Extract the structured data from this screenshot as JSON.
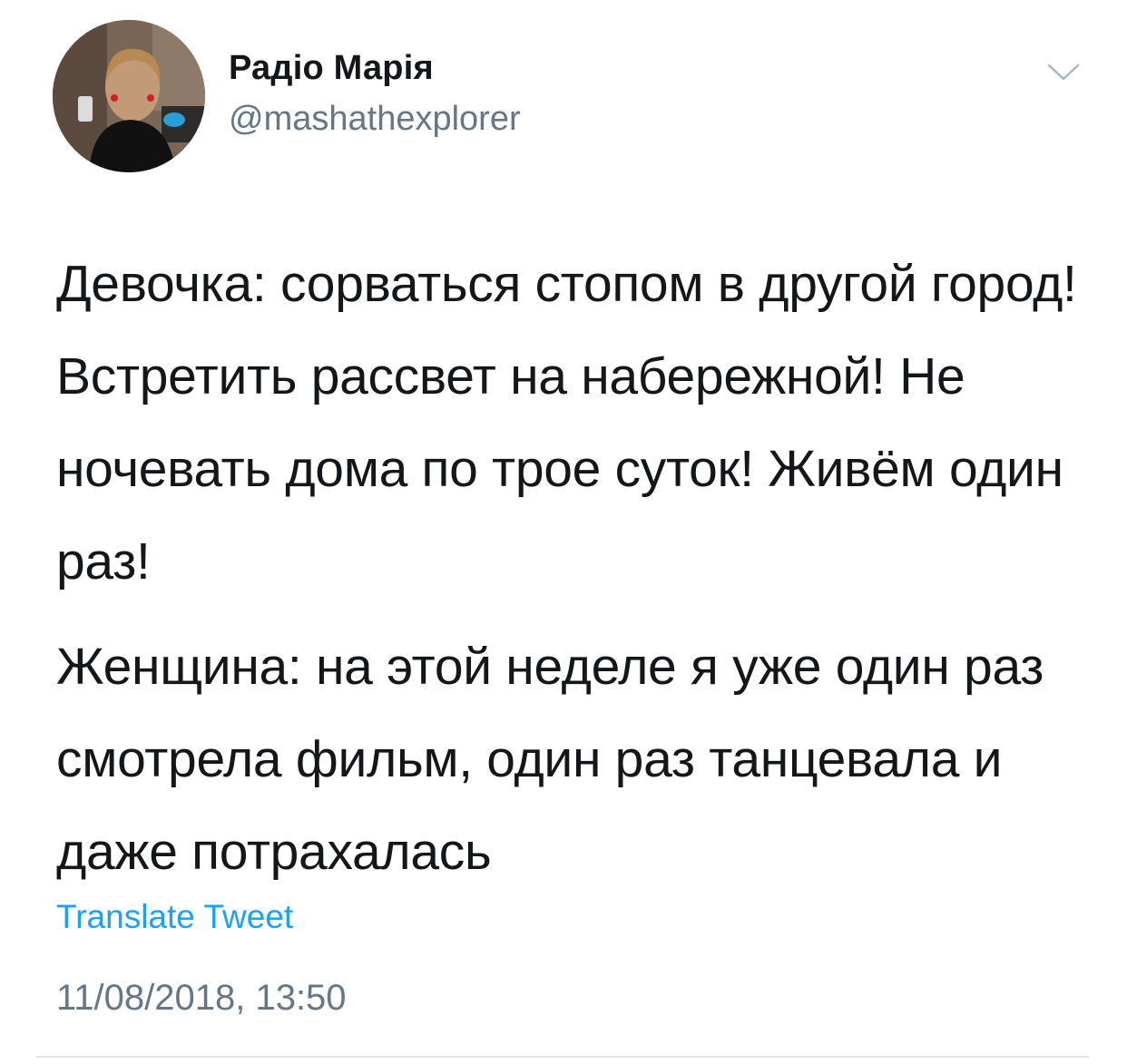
{
  "tweet": {
    "author": {
      "display_name": "Радіо Марія",
      "handle": "@mashathexplorer",
      "avatar_icon": "profile-photo"
    },
    "menu_icon": "chevron-down-icon",
    "paragraphs": [
      "Девочка: сорваться стопом в другой город! Встретить рассвет на набережной! Не ночевать дома по трое суток! Живём один раз!",
      "Женщина: на этой неделе я уже один раз смотрела фильм, один раз танцевала и даже потрахалась"
    ],
    "translate_label": "Translate Tweet",
    "timestamp": "11/08/2018, 13:50"
  },
  "colors": {
    "text": "#14171a",
    "secondary": "#657786",
    "link": "#1da1f2",
    "divider": "#e1e8ed"
  }
}
